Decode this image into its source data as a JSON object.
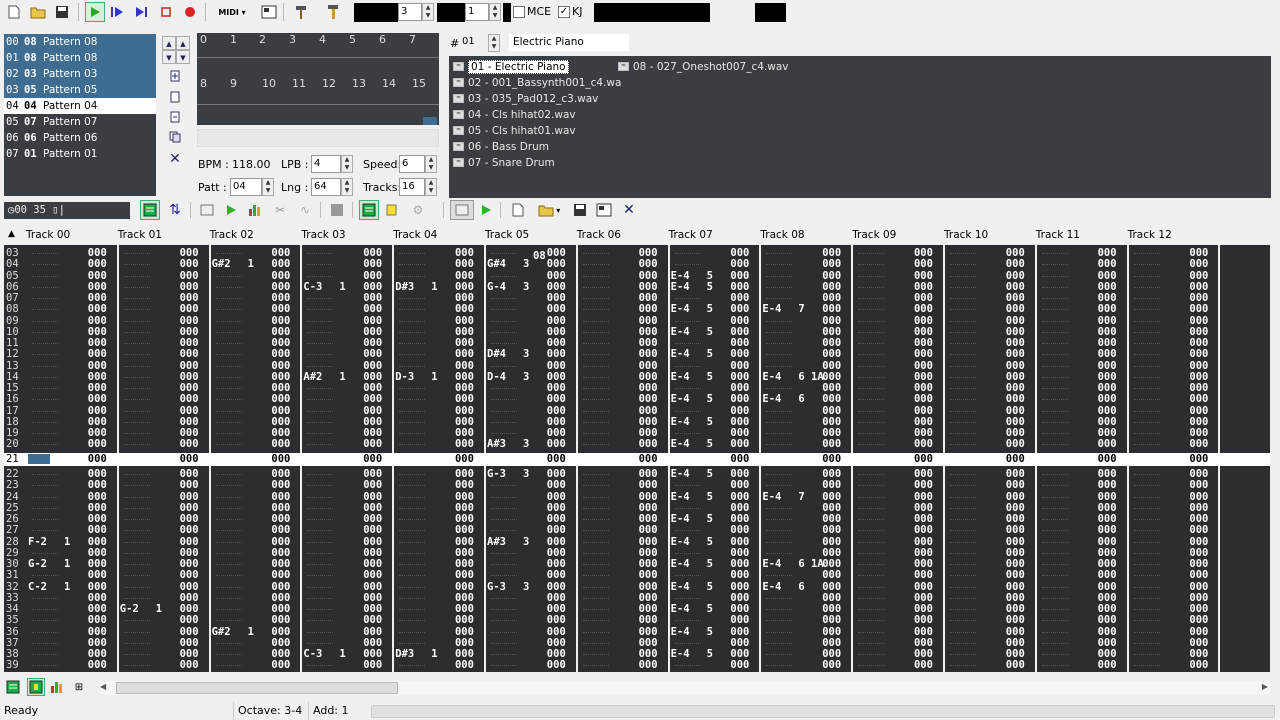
{
  "toolbar": {
    "icons": [
      "new-file-icon",
      "open-folder-icon",
      "save-icon",
      "play-icon",
      "play-pattern-icon",
      "play-from-cursor-icon",
      "stop-icon",
      "record-icon",
      "midi-icon",
      "settings-icon",
      "hammer-icon",
      "help-icon"
    ],
    "midi_label": "MIDI",
    "field_a": "3",
    "field_b": "1",
    "mce_label": "MCE",
    "kj_label": "KJ"
  },
  "patterns": [
    {
      "pos": "00",
      "pat": "08",
      "name": "Pattern 08",
      "state": "sel"
    },
    {
      "pos": "01",
      "pat": "08",
      "name": "Pattern 08",
      "state": "sel"
    },
    {
      "pos": "02",
      "pat": "03",
      "name": "Pattern 03",
      "state": "sel"
    },
    {
      "pos": "03",
      "pat": "05",
      "name": "Pattern 05",
      "state": "sel"
    },
    {
      "pos": "04",
      "pat": "04",
      "name": "Pattern 04",
      "state": "act"
    },
    {
      "pos": "05",
      "pat": "07",
      "name": "Pattern 07",
      "state": ""
    },
    {
      "pos": "06",
      "pat": "06",
      "name": "Pattern 06",
      "state": ""
    },
    {
      "pos": "07",
      "pat": "01",
      "name": "Pattern 01",
      "state": ""
    }
  ],
  "seq_numbers_top": [
    "0",
    "1",
    "2",
    "3",
    "4",
    "5",
    "6",
    "7"
  ],
  "seq_numbers_bottom": [
    "8",
    "9",
    "10",
    "11",
    "12",
    "13",
    "14",
    "15"
  ],
  "settings": {
    "bpm_label": "BPM :",
    "bpm": "118.00",
    "lpb_label": "LPB :",
    "lpb": "4",
    "speed_label": "Speed:",
    "speed": "6",
    "patt_label": "Patt :",
    "patt": "04",
    "lng_label": "Lng :",
    "lng": "64",
    "tracks_label": "Tracks:",
    "tracks": "16"
  },
  "instrument": {
    "hash": "#",
    "number": "01",
    "name": "Electric Piano"
  },
  "instruments_col1": [
    "01 - Electric Piano",
    "02 - 001_Bassynth001_c4.wa",
    "03 - 035_Pad012_c3.wav",
    "04 - Cls hihat02.wav",
    "05 - Cls hihat01.wav",
    "06 - Bass Drum",
    "07 - Snare Drum"
  ],
  "instruments_col2": [
    "08 - 027_Oneshot007_c4.wav"
  ],
  "timer": "◷00 35 ▯|",
  "track_headers": [
    "Track 00",
    "Track 01",
    "Track 02",
    "Track 03",
    "Track 04",
    "Track 05",
    "Track 06",
    "Track 07",
    "Track 08",
    "Track 09",
    "Track 10",
    "Track 11",
    "Track 12"
  ],
  "current_row": "21",
  "status": {
    "ready": "Ready",
    "octave": "Octave: 3-4",
    "add": "Add: 1"
  },
  "empty_val": "000",
  "rows_top": [
    "03",
    "04",
    "05",
    "06",
    "07",
    "08",
    "09",
    "10",
    "11",
    "12",
    "13",
    "14",
    "15",
    "16",
    "17",
    "18",
    "19",
    "20"
  ],
  "rows_bottom": [
    "22",
    "23",
    "24",
    "25",
    "26",
    "27",
    "28",
    "29",
    "30",
    "31",
    "32",
    "33",
    "34",
    "35",
    "36",
    "37",
    "38",
    "39"
  ],
  "notes": {
    "04": {
      "2": [
        "G#2",
        "1"
      ],
      "5": [
        "G#4",
        "3"
      ]
    },
    "06": {
      "3": [
        "C-3",
        "1"
      ],
      "4": [
        "D#3",
        "1"
      ],
      "5": [
        "G-4",
        "3"
      ],
      "7": [
        "E-4",
        "5"
      ]
    },
    "04b": {
      "7": [
        "E-4",
        "5"
      ]
    },
    "08": {
      "7": [
        "E-4",
        "5"
      ],
      "8": [
        "E-4",
        "7"
      ]
    },
    "10": {
      "7": [
        "E-4",
        "5"
      ]
    },
    "12": {
      "5": [
        "D#4",
        "3"
      ],
      "7": [
        "E-4",
        "5"
      ]
    },
    "14": {
      "3": [
        "A#2",
        "1"
      ],
      "4": [
        "D-3",
        "1"
      ],
      "5": [
        "D-4",
        "3"
      ],
      "7": [
        "E-4",
        "5"
      ],
      "8": [
        "E-4",
        "6 1A"
      ]
    },
    "16": {
      "7": [
        "E-4",
        "5"
      ],
      "8": [
        "E-4",
        "6"
      ]
    },
    "18": {
      "7": [
        "E-4",
        "5"
      ]
    },
    "20": {
      "5": [
        "A#3",
        "3"
      ],
      "7": [
        "E-4",
        "5"
      ]
    },
    "22": {
      "5": [
        "G-3",
        "3"
      ],
      "7": [
        "E-4",
        "5"
      ]
    },
    "24": {
      "7": [
        "E-4",
        "5"
      ],
      "8": [
        "E-4",
        "7"
      ]
    },
    "26": {
      "7": [
        "E-4",
        "5"
      ]
    },
    "28": {
      "0": [
        "F-2",
        "1"
      ],
      "5": [
        "A#3",
        "3"
      ],
      "7": [
        "E-4",
        "5"
      ]
    },
    "30": {
      "0": [
        "G-2",
        "1"
      ],
      "7": [
        "E-4",
        "5"
      ],
      "8": [
        "E-4",
        "6 1A"
      ]
    },
    "32": {
      "0": [
        "C-2",
        "1"
      ],
      "5": [
        "G-3",
        "3"
      ],
      "7": [
        "E-4",
        "5"
      ],
      "8": [
        "E-4",
        "6"
      ]
    },
    "34": {
      "1": [
        "G-2",
        "1"
      ],
      "7": [
        "E-4",
        "5"
      ]
    },
    "36": {
      "2": [
        "G#2",
        "1"
      ],
      "7": [
        "E-4",
        "5"
      ]
    },
    "38": {
      "3": [
        "C-3",
        "1"
      ],
      "4": [
        "D#3",
        "1"
      ],
      "7": [
        "E-4",
        "5"
      ]
    }
  },
  "row04_extra": {
    "5": "08"
  },
  "colors": {
    "panel": "#3a3d42",
    "pattern_bg": "#2b2d31",
    "selected": "#3f6c91"
  }
}
